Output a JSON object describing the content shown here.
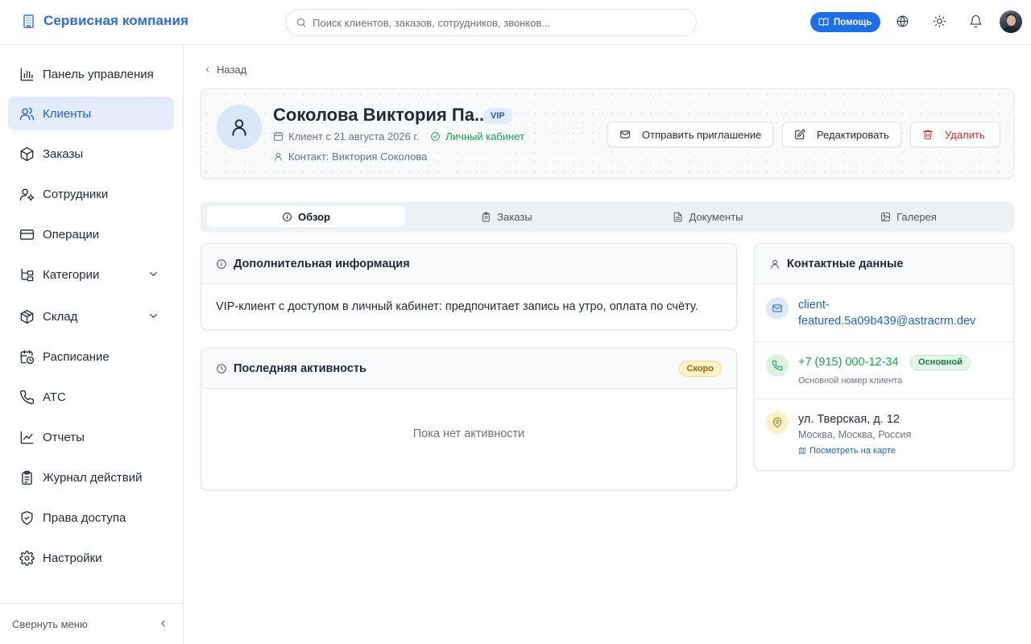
{
  "app": {
    "name": "Сервисная компания"
  },
  "search": {
    "placeholder": "Поиск клиентов, заказов, сотрудников, звонков..."
  },
  "header": {
    "help_label": "Помощь"
  },
  "sidebar": {
    "items": [
      {
        "label": "Панель управления",
        "icon": "bar-chart-icon"
      },
      {
        "label": "Клиенты",
        "icon": "users-icon",
        "active": true
      },
      {
        "label": "Заказы",
        "icon": "box-icon"
      },
      {
        "label": "Сотрудники",
        "icon": "user-gear-icon"
      },
      {
        "label": "Операции",
        "icon": "credit-card-icon"
      },
      {
        "label": "Категории",
        "icon": "tree-icon",
        "expandable": true
      },
      {
        "label": "Склад",
        "icon": "package-icon",
        "expandable": true
      },
      {
        "label": "Расписание",
        "icon": "calendar-clock-icon"
      },
      {
        "label": "АТС",
        "icon": "phone-icon"
      },
      {
        "label": "Отчеты",
        "icon": "line-chart-icon"
      },
      {
        "label": "Журнал действий",
        "icon": "clipboard-icon"
      },
      {
        "label": "Права доступа",
        "icon": "shield-icon"
      },
      {
        "label": "Настройки",
        "icon": "gear-icon"
      }
    ],
    "collapse_label": "Свернуть меню"
  },
  "back_label": "Назад",
  "client": {
    "name": "Соколова Виктория Па...",
    "badge": "VIP",
    "since": "Клиент с 21 августа 2026 г.",
    "cabinet": "Личный кабинет",
    "contact": "Контакт: Виктория Соколова"
  },
  "actions": {
    "invite": "Отправить приглашение",
    "edit": "Редактировать",
    "delete": "Удалить"
  },
  "tabs": [
    {
      "label": "Обзор",
      "icon": "info-icon",
      "active": true
    },
    {
      "label": "Заказы",
      "icon": "clipboard-icon"
    },
    {
      "label": "Документы",
      "icon": "document-icon"
    },
    {
      "label": "Галерея",
      "icon": "image-icon"
    }
  ],
  "info_card": {
    "title": "Дополнительная информация",
    "text": "VIP-клиент с доступом в личный кабинет: предпочитает запись на утро, оплата по счёту."
  },
  "activity_card": {
    "title": "Последняя активность",
    "badge": "Скоро",
    "empty": "Пока нет активности"
  },
  "contacts": {
    "title": "Контактные данные",
    "email_line1": "client-",
    "email_line2": "featured.5a09b439@astracrm.dev",
    "phone": "+7 (915) 000-12-34",
    "phone_badge": "Основной",
    "phone_note": "Основной номер клиента",
    "address": "ул. Тверская, д. 12",
    "city": "Москва, Москва, Россия",
    "map_link": "Посмотреть на карте"
  },
  "colors": {
    "brand": "#2b6cd9",
    "active_nav_bg": "#e3ecfb",
    "success": "#16a34a",
    "danger": "#dc2626",
    "link": "#1d5fd6"
  }
}
